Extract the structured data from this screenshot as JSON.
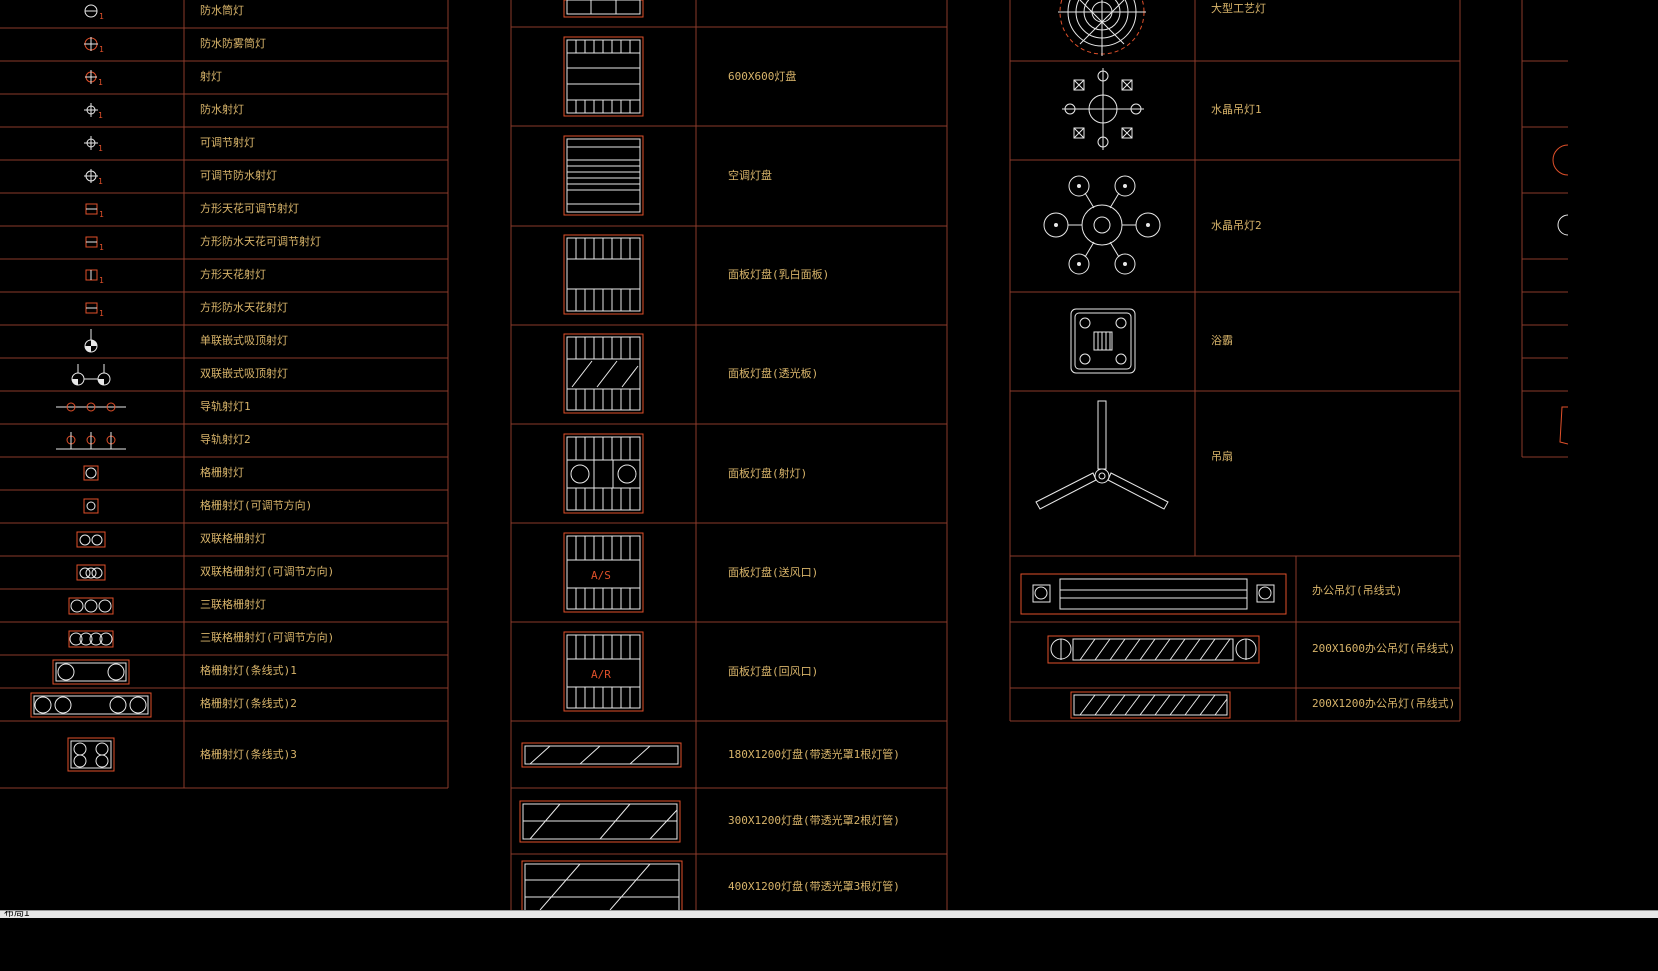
{
  "col1": [
    "防水筒灯",
    "防水防雾筒灯",
    "射灯",
    "防水射灯",
    "可调节射灯",
    "可调节防水射灯",
    "方形天花可调节射灯",
    "方形防水天花可调节射灯",
    "方形天花射灯",
    "方形防水天花射灯",
    "单联嵌式吸顶射灯",
    "双联嵌式吸顶射灯",
    "导轨射灯1",
    "导轨射灯2",
    "格栅射灯",
    "格栅射灯(可调节方向)",
    "双联格栅射灯",
    "双联格栅射灯(可调节方向)",
    "三联格栅射灯",
    "三联格栅射灯(可调节方向)",
    "格栅射灯(条线式)1",
    "格栅射灯(条线式)2",
    "格栅射灯(条线式)3"
  ],
  "col2": [
    "",
    "600X600灯盘",
    "空调灯盘",
    "面板灯盘(乳白面板)",
    "面板灯盘(透光板)",
    "面板灯盘(射灯)",
    "面板灯盘(送风口)",
    "面板灯盘(回风口)",
    "180X1200灯盘(带透光罩1根灯管)",
    "300X1200灯盘(带透光罩2根灯管)",
    "400X1200灯盘(带透光罩3根灯管)"
  ],
  "col2_marks": {
    "supply": "A/S",
    "return": "A/R"
  },
  "col3": [
    "大型工艺灯",
    "水晶吊灯1",
    "水晶吊灯2",
    "浴霸",
    "吊扇"
  ],
  "col3b": [
    "办公吊灯(吊线式)",
    "200X1600办公吊灯(吊线式)",
    "200X1200办公吊灯(吊线式)"
  ],
  "status": {
    "tab": "布局1"
  },
  "colors": {
    "grid": "#8a3a2a",
    "red": "#e0502a",
    "white": "#e8e8e8",
    "text": "#d8b46a"
  }
}
